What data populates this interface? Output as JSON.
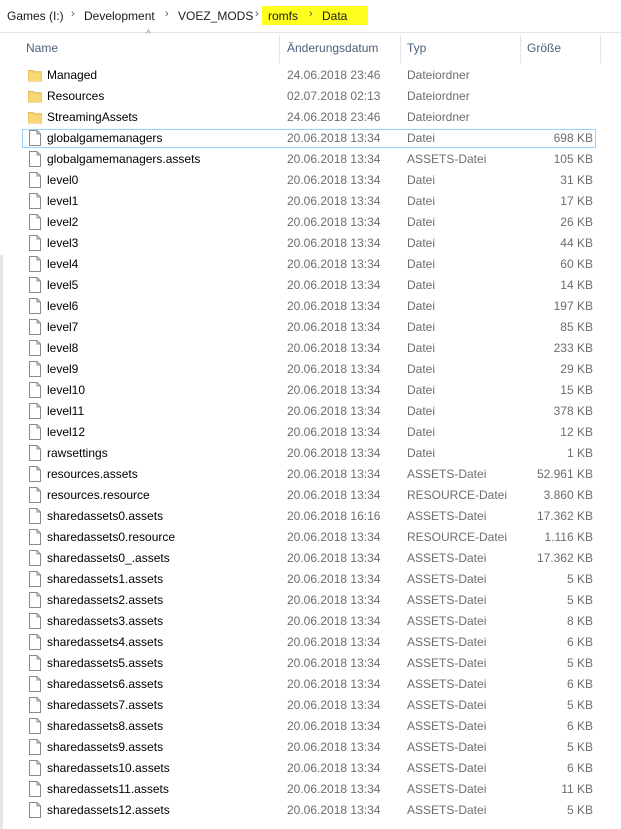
{
  "breadcrumb": {
    "items": [
      "Games (I:)",
      "Development",
      "VOEZ_MODS",
      "romfs",
      "Data"
    ],
    "highlighted": [
      "romfs",
      "Data"
    ],
    "highlight_color": "#ffff20"
  },
  "columns": {
    "name": "Name",
    "date": "Änderungsdatum",
    "type": "Typ",
    "size": "Größe"
  },
  "sort_indicator": "^",
  "colors": {
    "folder": "#f8d775",
    "focus_border": "#99d1ff",
    "header_text": "#4c607a",
    "detail_text": "#6d6d6d"
  },
  "files": [
    {
      "name": "Managed",
      "date": "24.06.2018 23:46",
      "type": "Dateiordner",
      "size": "",
      "icon": "folder-icon"
    },
    {
      "name": "Resources",
      "date": "02.07.2018 02:13",
      "type": "Dateiordner",
      "size": "",
      "icon": "folder-icon"
    },
    {
      "name": "StreamingAssets",
      "date": "24.06.2018 23:46",
      "type": "Dateiordner",
      "size": "",
      "icon": "folder-icon"
    },
    {
      "name": "globalgamemanagers",
      "date": "20.06.2018 13:34",
      "type": "Datei",
      "size": "698 KB",
      "icon": "file-icon",
      "focused": true
    },
    {
      "name": "globalgamemanagers.assets",
      "date": "20.06.2018 13:34",
      "type": "ASSETS-Datei",
      "size": "105 KB",
      "icon": "file-icon"
    },
    {
      "name": "level0",
      "date": "20.06.2018 13:34",
      "type": "Datei",
      "size": "31 KB",
      "icon": "file-icon"
    },
    {
      "name": "level1",
      "date": "20.06.2018 13:34",
      "type": "Datei",
      "size": "17 KB",
      "icon": "file-icon"
    },
    {
      "name": "level2",
      "date": "20.06.2018 13:34",
      "type": "Datei",
      "size": "26 KB",
      "icon": "file-icon"
    },
    {
      "name": "level3",
      "date": "20.06.2018 13:34",
      "type": "Datei",
      "size": "44 KB",
      "icon": "file-icon"
    },
    {
      "name": "level4",
      "date": "20.06.2018 13:34",
      "type": "Datei",
      "size": "60 KB",
      "icon": "file-icon"
    },
    {
      "name": "level5",
      "date": "20.06.2018 13:34",
      "type": "Datei",
      "size": "14 KB",
      "icon": "file-icon"
    },
    {
      "name": "level6",
      "date": "20.06.2018 13:34",
      "type": "Datei",
      "size": "197 KB",
      "icon": "file-icon"
    },
    {
      "name": "level7",
      "date": "20.06.2018 13:34",
      "type": "Datei",
      "size": "85 KB",
      "icon": "file-icon"
    },
    {
      "name": "level8",
      "date": "20.06.2018 13:34",
      "type": "Datei",
      "size": "233 KB",
      "icon": "file-icon"
    },
    {
      "name": "level9",
      "date": "20.06.2018 13:34",
      "type": "Datei",
      "size": "29 KB",
      "icon": "file-icon"
    },
    {
      "name": "level10",
      "date": "20.06.2018 13:34",
      "type": "Datei",
      "size": "15 KB",
      "icon": "file-icon"
    },
    {
      "name": "level11",
      "date": "20.06.2018 13:34",
      "type": "Datei",
      "size": "378 KB",
      "icon": "file-icon"
    },
    {
      "name": "level12",
      "date": "20.06.2018 13:34",
      "type": "Datei",
      "size": "12 KB",
      "icon": "file-icon"
    },
    {
      "name": "rawsettings",
      "date": "20.06.2018 13:34",
      "type": "Datei",
      "size": "1 KB",
      "icon": "file-icon"
    },
    {
      "name": "resources.assets",
      "date": "20.06.2018 13:34",
      "type": "ASSETS-Datei",
      "size": "52.961 KB",
      "icon": "file-icon"
    },
    {
      "name": "resources.resource",
      "date": "20.06.2018 13:34",
      "type": "RESOURCE-Datei",
      "size": "3.860 KB",
      "icon": "file-icon"
    },
    {
      "name": "sharedassets0.assets",
      "date": "20.06.2018 16:16",
      "type": "ASSETS-Datei",
      "size": "17.362 KB",
      "icon": "file-icon"
    },
    {
      "name": "sharedassets0.resource",
      "date": "20.06.2018 13:34",
      "type": "RESOURCE-Datei",
      "size": "1.116 KB",
      "icon": "file-icon"
    },
    {
      "name": "sharedassets0_.assets",
      "date": "20.06.2018 13:34",
      "type": "ASSETS-Datei",
      "size": "17.362 KB",
      "icon": "file-icon"
    },
    {
      "name": "sharedassets1.assets",
      "date": "20.06.2018 13:34",
      "type": "ASSETS-Datei",
      "size": "5 KB",
      "icon": "file-icon"
    },
    {
      "name": "sharedassets2.assets",
      "date": "20.06.2018 13:34",
      "type": "ASSETS-Datei",
      "size": "5 KB",
      "icon": "file-icon"
    },
    {
      "name": "sharedassets3.assets",
      "date": "20.06.2018 13:34",
      "type": "ASSETS-Datei",
      "size": "8 KB",
      "icon": "file-icon"
    },
    {
      "name": "sharedassets4.assets",
      "date": "20.06.2018 13:34",
      "type": "ASSETS-Datei",
      "size": "6 KB",
      "icon": "file-icon"
    },
    {
      "name": "sharedassets5.assets",
      "date": "20.06.2018 13:34",
      "type": "ASSETS-Datei",
      "size": "5 KB",
      "icon": "file-icon"
    },
    {
      "name": "sharedassets6.assets",
      "date": "20.06.2018 13:34",
      "type": "ASSETS-Datei",
      "size": "6 KB",
      "icon": "file-icon"
    },
    {
      "name": "sharedassets7.assets",
      "date": "20.06.2018 13:34",
      "type": "ASSETS-Datei",
      "size": "5 KB",
      "icon": "file-icon"
    },
    {
      "name": "sharedassets8.assets",
      "date": "20.06.2018 13:34",
      "type": "ASSETS-Datei",
      "size": "6 KB",
      "icon": "file-icon"
    },
    {
      "name": "sharedassets9.assets",
      "date": "20.06.2018 13:34",
      "type": "ASSETS-Datei",
      "size": "5 KB",
      "icon": "file-icon"
    },
    {
      "name": "sharedassets10.assets",
      "date": "20.06.2018 13:34",
      "type": "ASSETS-Datei",
      "size": "6 KB",
      "icon": "file-icon"
    },
    {
      "name": "sharedassets11.assets",
      "date": "20.06.2018 13:34",
      "type": "ASSETS-Datei",
      "size": "11 KB",
      "icon": "file-icon"
    },
    {
      "name": "sharedassets12.assets",
      "date": "20.06.2018 13:34",
      "type": "ASSETS-Datei",
      "size": "5 KB",
      "icon": "file-icon"
    }
  ]
}
